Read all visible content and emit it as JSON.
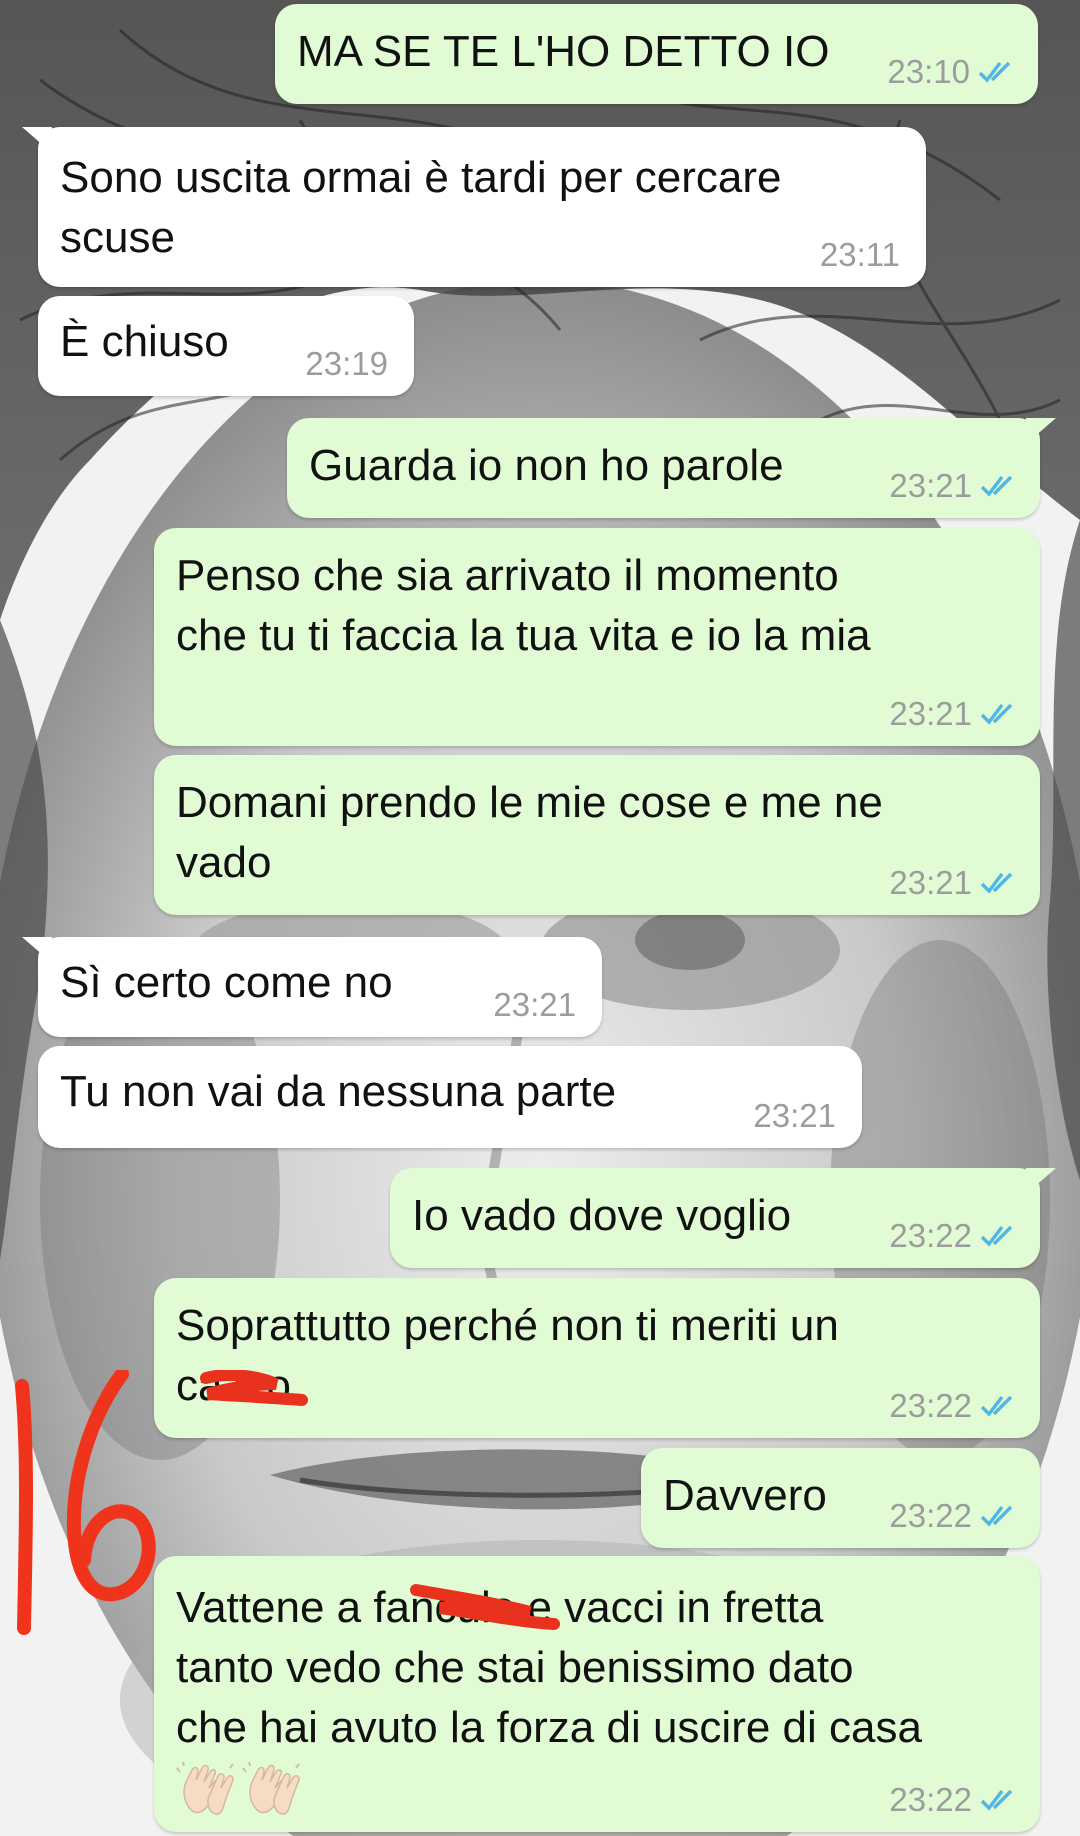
{
  "chat": {
    "messages": [
      {
        "id": "m1",
        "dir": "out",
        "text": "MA SE TE L'HO DETTO IO",
        "time": "23:10",
        "status": "read"
      },
      {
        "id": "m2",
        "dir": "in",
        "text": "Sono uscita ormai è tardi per cercare\nscuse",
        "time": "23:11"
      },
      {
        "id": "m3",
        "dir": "in",
        "text": "È chiuso",
        "time": "23:19"
      },
      {
        "id": "m4",
        "dir": "out",
        "text": "Guarda io non ho parole",
        "time": "23:21",
        "status": "read"
      },
      {
        "id": "m5",
        "dir": "out",
        "text": "Penso che sia arrivato il momento\nche tu ti faccia la tua vita e io la mia",
        "time": "23:21",
        "status": "read"
      },
      {
        "id": "m6",
        "dir": "out",
        "text": "Domani prendo le mie cose e me ne\nvado",
        "time": "23:21",
        "status": "read"
      },
      {
        "id": "m7",
        "dir": "in",
        "text": "Sì certo come no",
        "time": "23:21"
      },
      {
        "id": "m8",
        "dir": "in",
        "text": "Tu non vai da nessuna parte",
        "time": "23:21"
      },
      {
        "id": "m9",
        "dir": "out",
        "text": "Io vado dove voglio",
        "time": "23:22",
        "status": "read"
      },
      {
        "id": "m10",
        "dir": "out",
        "text": "Soprattutto perché non ti meriti un\ncazzo",
        "time": "23:22",
        "status": "read"
      },
      {
        "id": "m11",
        "dir": "out",
        "text": "Davvero",
        "time": "23:22",
        "status": "read"
      },
      {
        "id": "m12",
        "dir": "out",
        "text": "Vattene a fanculo e vacci in fretta\ntanto vedo che stai benissimo dato\nche hai avuto la forza di uscire di casa",
        "time": "23:22",
        "status": "read",
        "emoji": [
          "clapping-hands-icon",
          "clapping-hands-icon"
        ]
      }
    ]
  },
  "annotation": {
    "text": "16",
    "color": "#f0341c"
  },
  "colors": {
    "outgoing_bubble": "#e1fcd4",
    "incoming_bubble": "#ffffff",
    "read_ticks": "#4fb6ec",
    "timestamp": "#9c9c9c",
    "scribble": "#e8321e"
  }
}
